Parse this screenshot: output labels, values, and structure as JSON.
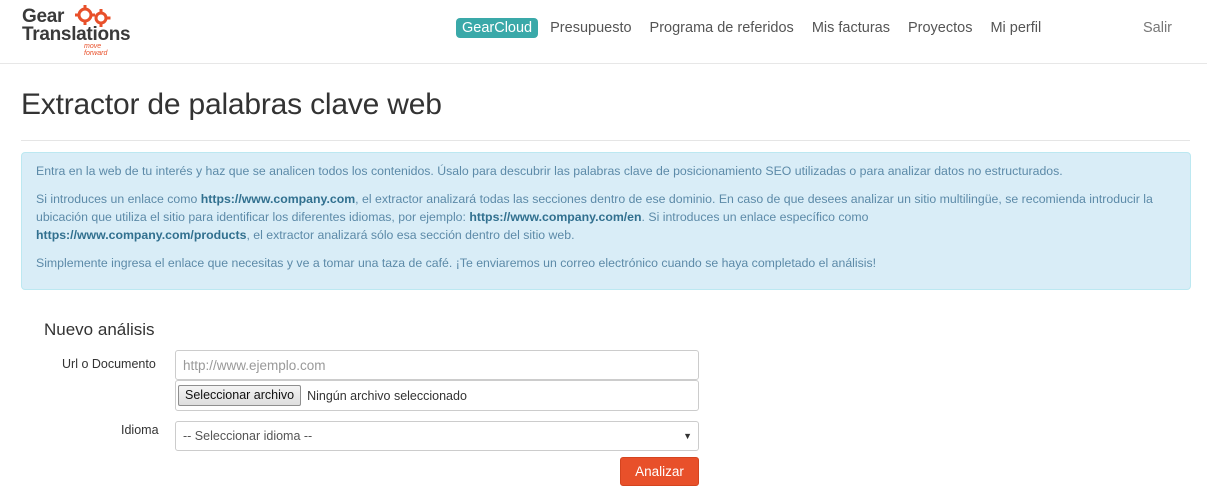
{
  "brand": {
    "name_line1": "Gear",
    "name_line2": "Translations",
    "tagline": "move forward",
    "accent_color": "#e8502a"
  },
  "nav": {
    "items": [
      {
        "label": "GearCloud",
        "active": true
      },
      {
        "label": "Presupuesto"
      },
      {
        "label": "Programa de referidos"
      },
      {
        "label": "Mis facturas"
      },
      {
        "label": "Proyectos"
      },
      {
        "label": "Mi perfil"
      }
    ],
    "logout": "Salir"
  },
  "page": {
    "title": "Extractor de palabras clave web"
  },
  "info": {
    "p1": "Entra en la web de tu interés y haz que se analicen todos los contenidos. Úsalo para descubrir las palabras clave de posicionamiento SEO utilizadas o para analizar datos no estructurados.",
    "p2_a": "Si introduces un enlace como ",
    "p2_link1": "https://www.company.com",
    "p2_b": ", el extractor analizará todas las secciones dentro de ese dominio. En caso de que desees analizar un sitio multilingüe, se recomienda introducir la ubicación que utiliza el sitio para identificar los diferentes idiomas, por ejemplo: ",
    "p2_link2": "https://www.company.com/en",
    "p2_c": ". Si introduces un enlace específico como ",
    "p2_link3": "https://www.company.com/products",
    "p2_d": ", el extractor analizará sólo esa sección dentro del sitio web.",
    "p3": "Simplemente ingresa el enlace que necesitas y ve a tomar una taza de café. ¡Te enviaremos un correo electrónico cuando se haya completado el análisis!"
  },
  "form": {
    "title": "Nuevo análisis",
    "url_label": "Url o Documento",
    "url_placeholder": "http://www.ejemplo.com",
    "url_value": "",
    "file_button": "Seleccionar archivo",
    "file_status": "Ningún archivo seleccionado",
    "language_label": "Idioma",
    "language_selected": "-- Seleccionar idioma --",
    "submit": "Analizar"
  }
}
